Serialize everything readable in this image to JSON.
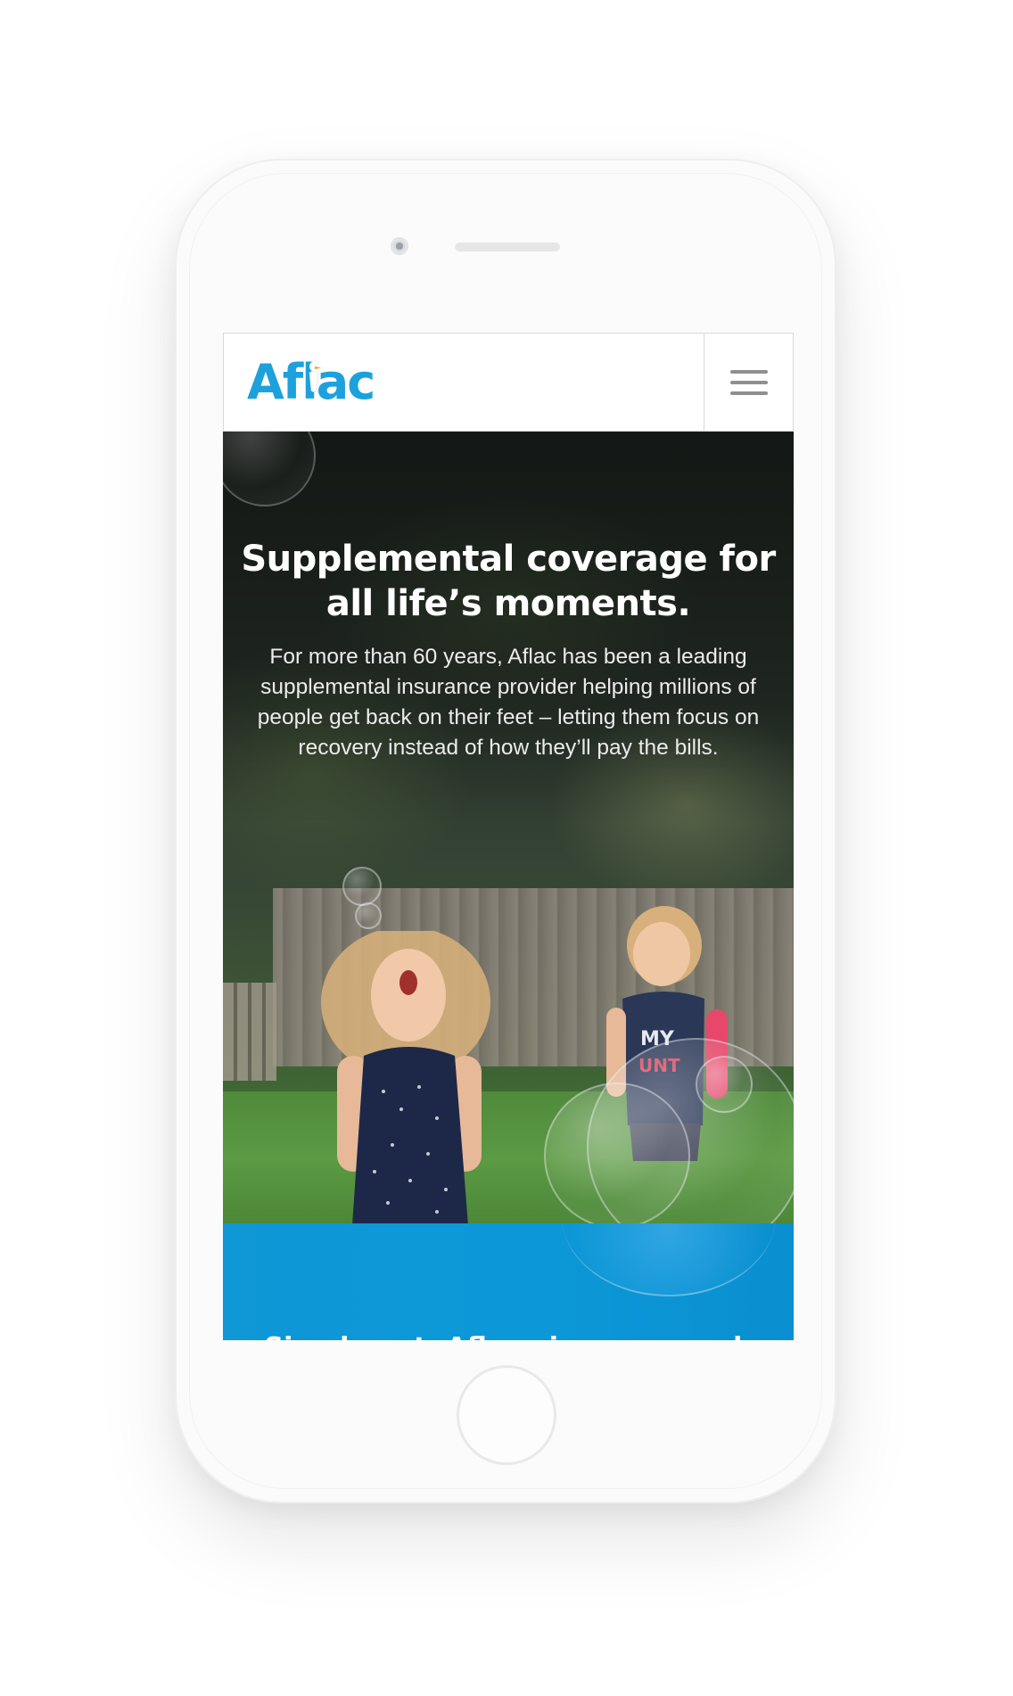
{
  "brand": {
    "logo_text": "Aflac",
    "colors": {
      "brand_blue": "#1da1dc",
      "band_blue": "#0c98d8",
      "header_border": "#d9d9d9",
      "menu_icon": "#8f8f8f",
      "hero_text": "#ffffff"
    }
  },
  "header": {
    "menu_icon": "hamburger-menu-icon"
  },
  "hero": {
    "title": "Supplemental coverage for all life’s moments.",
    "body": "For more than 60 years, Aflac has been a leading supplemental insurance provider helping millions of people get back on their feet – letting them focus on recovery instead of how they’ll pay the bills.",
    "photo_shirt_text": "I LOVE MY AUNT"
  },
  "band": {
    "heading": "Simply put, Aflac gives you cash"
  }
}
